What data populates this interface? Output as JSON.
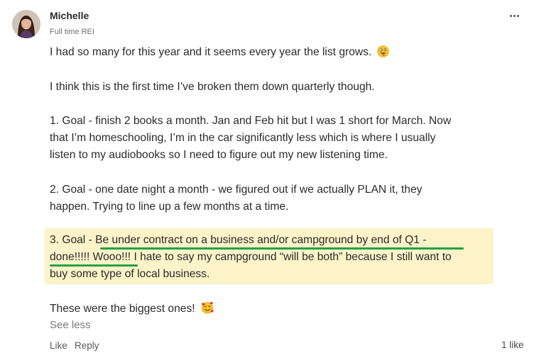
{
  "author": {
    "name": "Michelle",
    "role": "Full time REI"
  },
  "post": {
    "p1": "I had so many for this year and it seems every year the list grows.",
    "p2": "I think this is the first time I’ve broken them down quarterly though.",
    "goal1": [
      "1. Goal - finish 2 books a month.  Jan and Feb hit but I was 1 short for March.  Now",
      "that I’m homeschooling, I’m in the car significantly less which is where I usually",
      "listen to my audiobooks so I need to figure out my new listening time."
    ],
    "goal2": [
      "2. Goal - one date night a month - we figured out if we actually PLAN it, they",
      "happen. Trying to line up a few months at a time."
    ],
    "goal3": [
      "3. Goal - Be under contract on a business and/or campground by end of Q1 -",
      "done!!!!! Wooo!!! I hate to say my campground “will be both” because I still want to",
      "buy some type of local business."
    ],
    "closing": "These were the biggest ones!"
  },
  "icons": {
    "crazy_face": "zany-face-emoji",
    "smiling_hearts": "smiling-face-with-hearts-emoji",
    "more": "ellipsis-icon"
  },
  "colors": {
    "highlight": "#fcf3c8",
    "underline": "#23a046"
  },
  "actions": {
    "see_less": "See less",
    "like": "Like",
    "reply": "Reply",
    "like_count": "1 like"
  }
}
